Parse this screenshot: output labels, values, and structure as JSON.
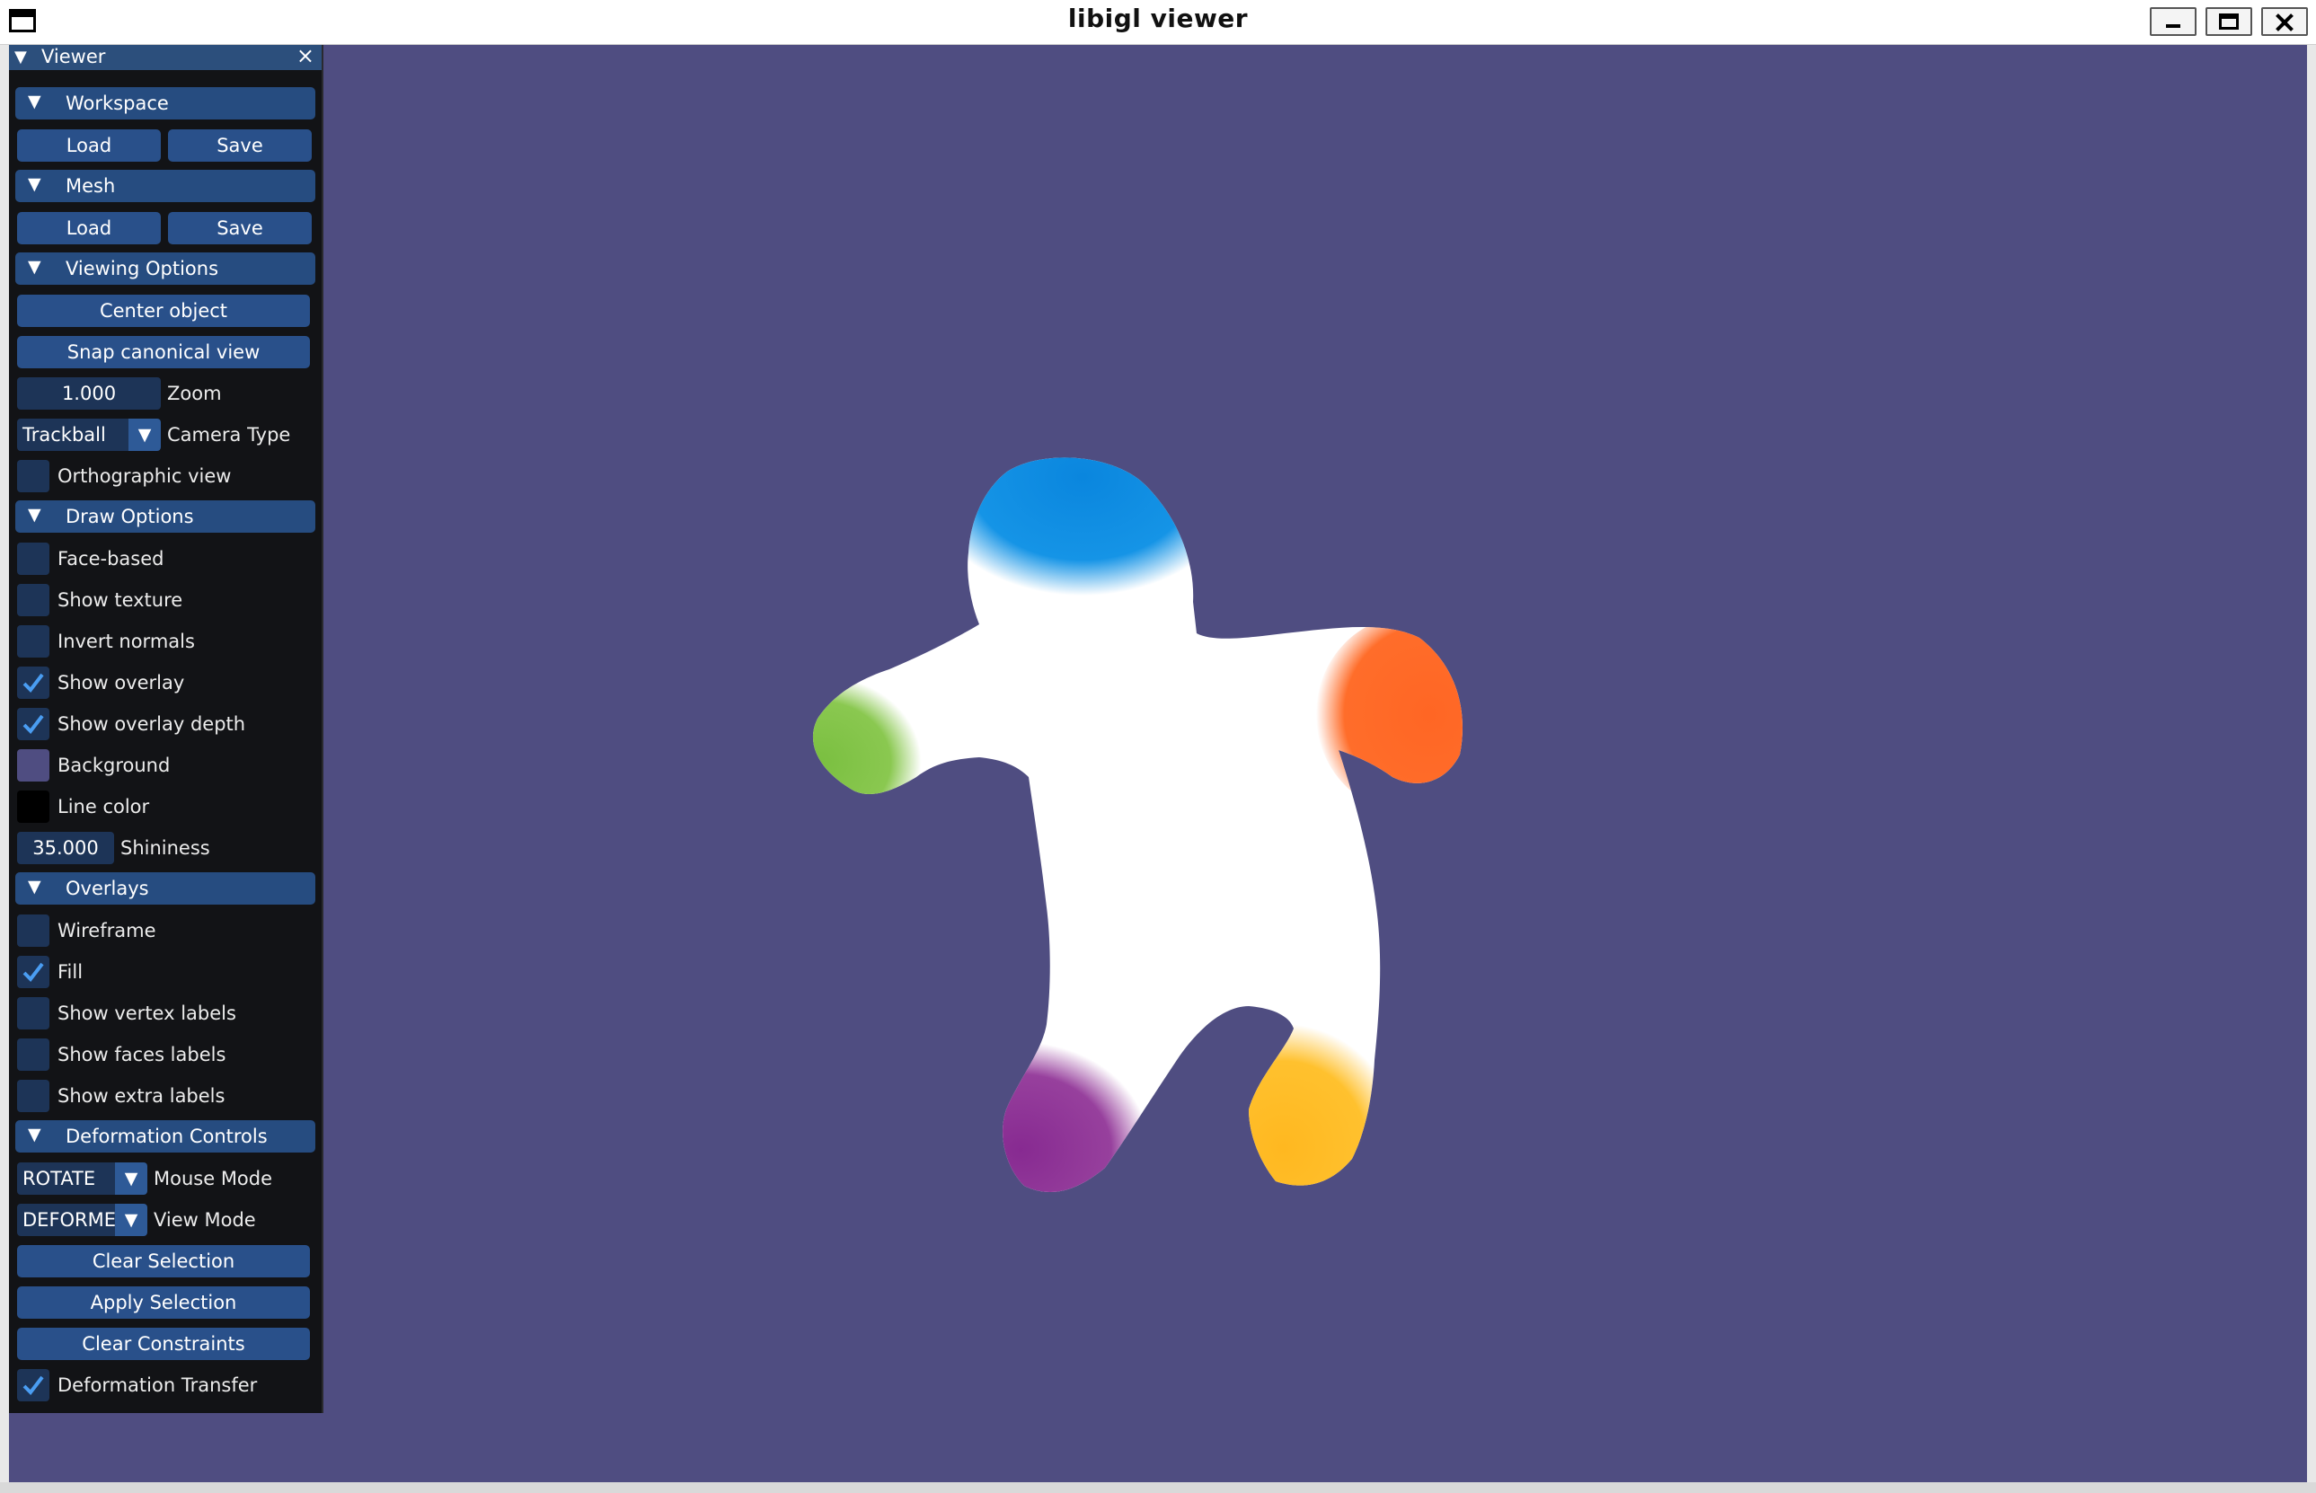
{
  "window": {
    "title": "libigl viewer"
  },
  "colors": {
    "viewport_bg": "#4f4d81",
    "background_swatch": "#4f4d81",
    "line_color_swatch": "#000000",
    "check_color": "#4a9df2",
    "mesh_blue": "#0e85dc",
    "mesh_orange": "#ff6a24",
    "mesh_green": "#7bc043",
    "mesh_purple": "#8b2d94",
    "mesh_yellow": "#ffbb22"
  },
  "panel": {
    "title": "Viewer",
    "close_icon": "×",
    "sections": {
      "workspace": {
        "label": "Workspace",
        "load": "Load",
        "save": "Save"
      },
      "mesh": {
        "label": "Mesh",
        "load": "Load",
        "save": "Save"
      },
      "viewing": {
        "label": "Viewing Options",
        "center": "Center object",
        "snap": "Snap canonical view",
        "zoom_value": "1.000",
        "zoom_label": "Zoom",
        "camera_value": "Trackball",
        "camera_label": "Camera Type",
        "ortho_label": "Orthographic view",
        "ortho_checked": false
      },
      "draw": {
        "label": "Draw Options",
        "face_based": "Face-based",
        "show_texture": "Show texture",
        "invert_normals": "Invert normals",
        "show_overlay": "Show overlay",
        "show_overlay_depth": "Show overlay depth",
        "background": "Background",
        "line_color": "Line color",
        "shininess_value": "35.000",
        "shininess_label": "Shininess"
      },
      "overlays": {
        "label": "Overlays",
        "wireframe": "Wireframe",
        "fill": "Fill",
        "vertex_labels": "Show vertex labels",
        "faces_labels": "Show faces labels",
        "extra_labels": "Show extra labels"
      },
      "deformation": {
        "label": "Deformation Controls",
        "mouse_value": "ROTATE",
        "mouse_label": "Mouse Mode",
        "view_value": "DEFORMED",
        "view_label": "View Mode",
        "clear_selection": "Clear Selection",
        "apply_selection": "Apply Selection",
        "clear_constraints": "Clear Constraints",
        "transfer_label": "Deformation Transfer"
      }
    },
    "arrow_icon": "▼"
  }
}
